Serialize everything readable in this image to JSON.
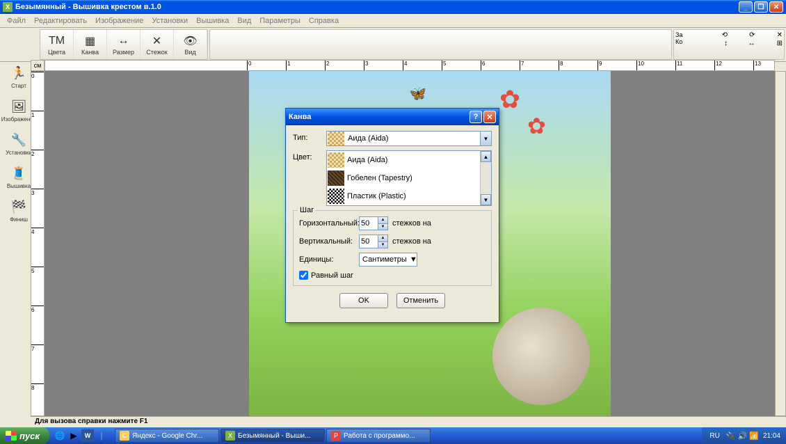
{
  "window": {
    "title": "Безымянный - Вышивка крестом в.1.0"
  },
  "menu": [
    "Файл",
    "Редактировать",
    "Изображение",
    "Установки",
    "Вышивка",
    "Вид",
    "Параметры",
    "Справка"
  ],
  "toolbar": [
    {
      "icon": "ТМ",
      "label": "Цвета"
    },
    {
      "icon": "▦",
      "label": "Канва"
    },
    {
      "icon": "↔",
      "label": "Размер"
    },
    {
      "icon": "✕",
      "label": "Стежок"
    },
    {
      "icon": "👁",
      "label": "Вид"
    }
  ],
  "toolbar_right": {
    "c1a": "За",
    "c1b": "Ко"
  },
  "side": [
    {
      "icon": "🏃",
      "label": "Старт"
    },
    {
      "icon": "🖼",
      "label": "Изображение"
    },
    {
      "icon": "🔧",
      "label": "Установки"
    },
    {
      "icon": "🧵",
      "label": "Вышивка"
    },
    {
      "icon": "🏁",
      "label": "Финиш"
    }
  ],
  "ruler_unit": "см",
  "dialog": {
    "title": "Канва",
    "type_label": "Тип:",
    "type_value": "Аида (Aida)",
    "color_label": "Цвет:",
    "options": [
      "Аида (Aida)",
      "Гобелен (Tapestry)",
      "Пластик (Plastic)"
    ],
    "step_legend": "Шаг",
    "horiz_label": "Горизонтальный:",
    "vert_label": "Вертикальный:",
    "horiz_value": "50",
    "vert_value": "50",
    "stitches_per": "стежков на",
    "units_label": "Единицы:",
    "units_value": "Сантиметры",
    "equal_step": "Равный шаг",
    "ok": "OK",
    "cancel": "Отменить"
  },
  "status": "Для вызова справки нажмите F1",
  "taskbar": {
    "start": "пуск",
    "items": [
      {
        "icon": "C",
        "label": "Яндекс - Google Chr...",
        "color": "#fc5"
      },
      {
        "icon": "X",
        "label": "Безымянный - Выши...",
        "color": "#7cb342",
        "active": true
      },
      {
        "icon": "P",
        "label": "Работа с программо...",
        "color": "#d44"
      }
    ],
    "lang": "RU",
    "time": "21:04"
  }
}
